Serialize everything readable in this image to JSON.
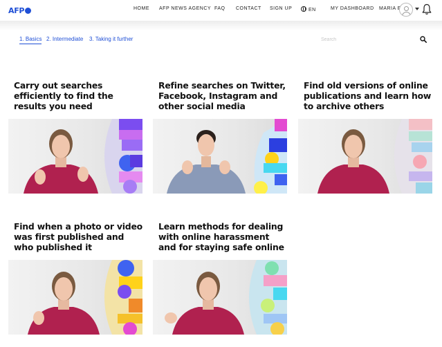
{
  "header": {
    "logo_text": "AFP",
    "nav": [
      {
        "key": "home",
        "label": "HOME"
      },
      {
        "key": "agency",
        "label": "AFP NEWS AGENCY"
      },
      {
        "key": "faq",
        "label": "FAQ"
      },
      {
        "key": "contact",
        "label": "CONTACT"
      },
      {
        "key": "signup",
        "label": "SIGN UP"
      },
      {
        "key": "lang",
        "label": "EN"
      },
      {
        "key": "dashboard",
        "label": "MY DASHBOARD"
      },
      {
        "key": "user",
        "label": "MARIA E"
      }
    ]
  },
  "tabs": [
    {
      "label": "1. Basics",
      "active": true
    },
    {
      "label": "2. Intermediate",
      "active": false
    },
    {
      "label": "3. Taking it further",
      "active": false
    }
  ],
  "search": {
    "placeholder": "Search",
    "value": ""
  },
  "courses": [
    {
      "title_lines": [
        "Carry out searches",
        "efficiently to find the",
        "results you need"
      ],
      "presenter": "woman",
      "accent": "purple"
    },
    {
      "title_lines": [
        "Refine searches on Twitter,",
        "Facebook, Instagram and",
        "other social media"
      ],
      "presenter": "man",
      "accent": "blue"
    },
    {
      "title_lines": [
        "Find old versions of online",
        "publications and learn how",
        "to archive others"
      ],
      "presenter": "woman",
      "accent": "pastel"
    },
    {
      "title_lines": [
        "Find when a photo or video",
        "was first published and",
        "who published it"
      ],
      "presenter": "woman",
      "accent": "yellow"
    },
    {
      "title_lines": [
        "Learn methods for dealing",
        "with online harassment",
        "and for staying safe online"
      ],
      "presenter": "woman",
      "accent": "cyan"
    }
  ],
  "colors": {
    "brand": "#1f4fd6",
    "shirt": "#b0214f",
    "man_shirt": "#8a9ab8"
  }
}
